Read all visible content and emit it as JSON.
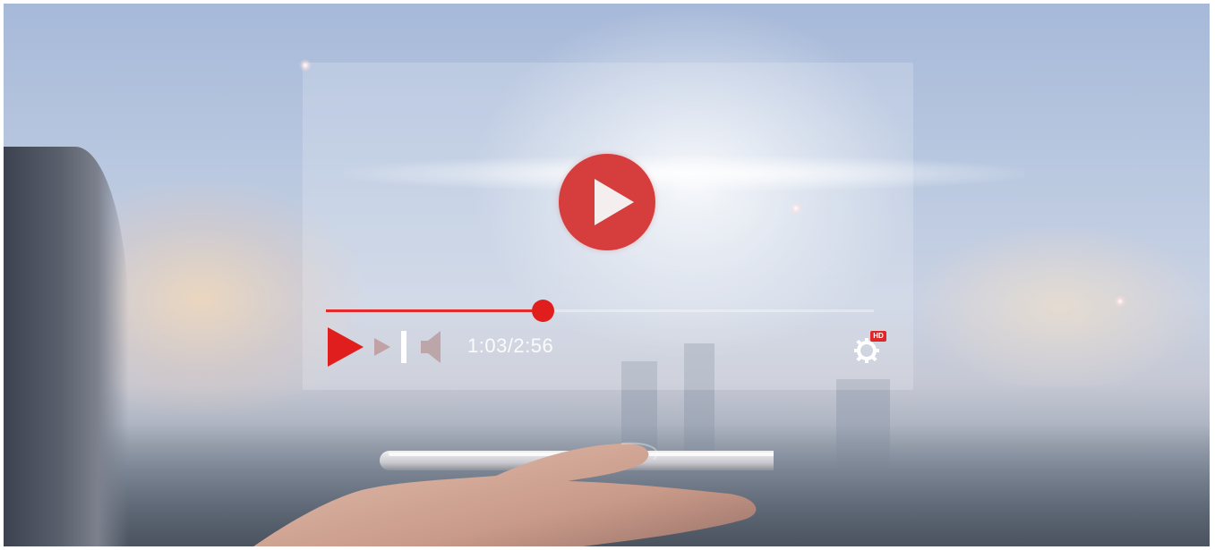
{
  "scene": {
    "description_colors": {
      "sky_top": "#a7b9d9",
      "sky_bottom": "#6d7682",
      "accent_red": "#e01e1e",
      "big_play_red": "#d63d3d"
    }
  },
  "player": {
    "big_play_icon": "play-circle-icon",
    "progress_fraction": 0.395,
    "time_display": "1:03/2:56",
    "controls": [
      {
        "name": "play-icon"
      },
      {
        "name": "next-icon"
      },
      {
        "name": "volume-icon"
      }
    ],
    "settings_icon": "gear-icon",
    "hd_badge": "HD"
  }
}
